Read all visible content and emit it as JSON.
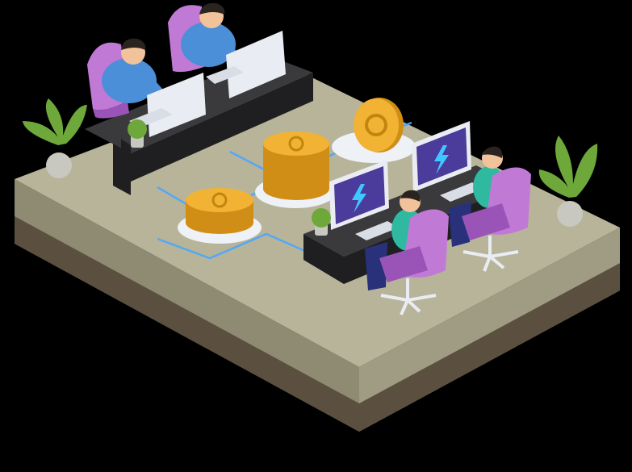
{
  "scene": {
    "subject": "isometric-gaming-office",
    "colors": {
      "background": "#000000",
      "floor_top": "#b7b49a",
      "floor_left": "#8f8b73",
      "floor_right": "#a09c83",
      "soil_band": "#5b503f",
      "desk_top": "#3a3a3c",
      "desk_front": "#1f1f21",
      "chair": "#c07ad6",
      "chair_dark": "#9a54b8",
      "shirt_blue": "#4a8fd8",
      "shirt_teal": "#2fb9a0",
      "skin": "#f2c29b",
      "hair": "#2a2320",
      "pants": "#28317a",
      "monitor_frame": "#e9ecf2",
      "monitor_screen": "#4b3b9a",
      "lightning": "#3fc8ff",
      "coin": "#f2b233",
      "coin_dark": "#d18e16",
      "pedestal": "#eef1f6",
      "glow_line": "#4aa6ff",
      "plant_leaf": "#6fa83a",
      "plant_pot": "#c8c8c0"
    }
  }
}
